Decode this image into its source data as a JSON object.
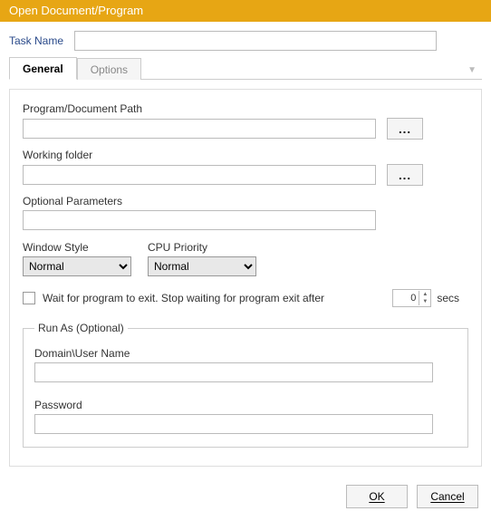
{
  "window": {
    "title": "Open Document/Program"
  },
  "task": {
    "label": "Task Name",
    "value": ""
  },
  "tabs": {
    "general": "General",
    "options": "Options"
  },
  "general": {
    "path_label": "Program/Document Path",
    "path_value": "",
    "folder_label": "Working folder",
    "folder_value": "",
    "params_label": "Optional Parameters",
    "params_value": "",
    "browse": "...",
    "window_style_label": "Window Style",
    "window_style_value": "Normal",
    "cpu_priority_label": "CPU Priority",
    "cpu_priority_value": "Normal",
    "wait_label": "Wait for program to exit. Stop waiting for program exit after",
    "wait_value": "0",
    "wait_unit": "secs",
    "runas": {
      "legend": "Run As (Optional)",
      "user_label": "Domain\\User Name",
      "user_value": "",
      "password_label": "Password",
      "password_value": ""
    }
  },
  "footer": {
    "ok": "OK",
    "cancel": "Cancel"
  }
}
